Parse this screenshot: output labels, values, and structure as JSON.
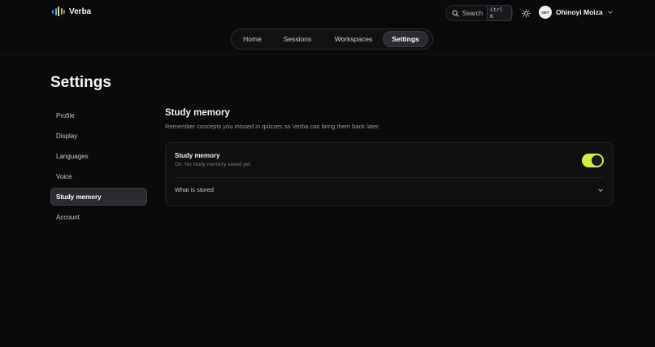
{
  "app": {
    "name": "Verba",
    "brand_colors": [
      "#7c6cf0",
      "#4aa8f5",
      "#d4ef42",
      "#f5a742"
    ]
  },
  "header": {
    "search": {
      "label": "Search",
      "shortcut": "Ctrl K"
    },
    "theme_icon": "sun-icon",
    "user": {
      "avatar_text": "GET",
      "name": "Ohinoyi Moiza"
    }
  },
  "nav": {
    "tabs": [
      {
        "label": "Home"
      },
      {
        "label": "Sessions"
      },
      {
        "label": "Workspaces"
      },
      {
        "label": "Settings",
        "active": true
      }
    ]
  },
  "page": {
    "title": "Settings"
  },
  "sidebar": {
    "items": [
      {
        "label": "Profile"
      },
      {
        "label": "Display"
      },
      {
        "label": "Languages"
      },
      {
        "label": "Voice"
      },
      {
        "label": "Study memory",
        "active": true
      },
      {
        "label": "Account"
      }
    ]
  },
  "section": {
    "title": "Study memory",
    "description": "Remember concepts you missed in quizzes so Verba can bring them back later."
  },
  "card": {
    "label": "Study memory",
    "status": "On. No study memory saved yet.",
    "toggle_on": true,
    "toggle_color": "#d4ef42",
    "expander_label": "What is stored"
  }
}
